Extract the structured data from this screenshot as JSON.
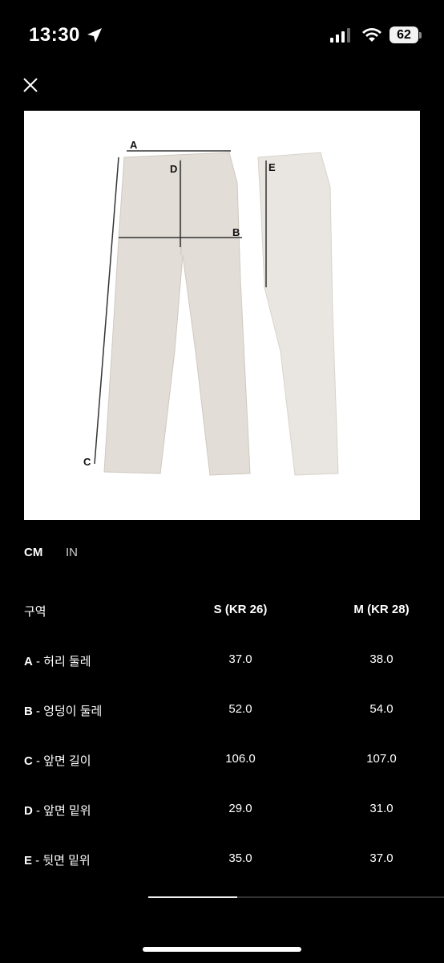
{
  "status": {
    "time": "13:30",
    "battery": "62"
  },
  "units": {
    "cm": "CM",
    "in": "IN"
  },
  "diagram": {
    "A": "A",
    "B": "B",
    "C": "C",
    "D": "D",
    "E": "E"
  },
  "table": {
    "headers": [
      "구역",
      "S (KR 26)",
      "M (KR 28)"
    ],
    "rows": [
      {
        "code": "A",
        "label": " - 허리 둘레",
        "s": "37.0",
        "m": "38.0"
      },
      {
        "code": "B",
        "label": " - 엉덩이 둘레",
        "s": "52.0",
        "m": "54.0"
      },
      {
        "code": "C",
        "label": " - 앞면 길이",
        "s": "106.0",
        "m": "107.0"
      },
      {
        "code": "D",
        "label": " - 앞면 밑위",
        "s": "29.0",
        "m": "31.0"
      },
      {
        "code": "E",
        "label": " - 뒷면 밑위",
        "s": "35.0",
        "m": "37.0"
      }
    ]
  }
}
